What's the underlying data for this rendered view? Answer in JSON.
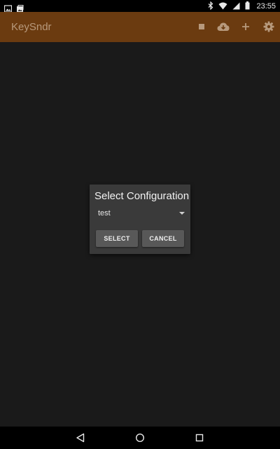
{
  "status_bar": {
    "time": "23:55",
    "left_icons": [
      "image-notification-icon",
      "photo-upload-notification-icon"
    ],
    "right_icons": [
      "bluetooth-icon",
      "wifi-icon",
      "signal-icon",
      "battery-icon"
    ]
  },
  "toolbar": {
    "title": "KeySndr",
    "background_color": "#6b3b10",
    "actions": [
      "stop-icon",
      "cloud-download-icon",
      "add-icon",
      "settings-icon"
    ]
  },
  "dialog": {
    "title": "Select Configuration",
    "spinner": {
      "selected": "test"
    },
    "buttons": {
      "select_label": "SELECT",
      "cancel_label": "CANCEL"
    }
  },
  "nav_bar": {
    "buttons": [
      "back-icon",
      "home-icon",
      "recents-icon"
    ]
  }
}
